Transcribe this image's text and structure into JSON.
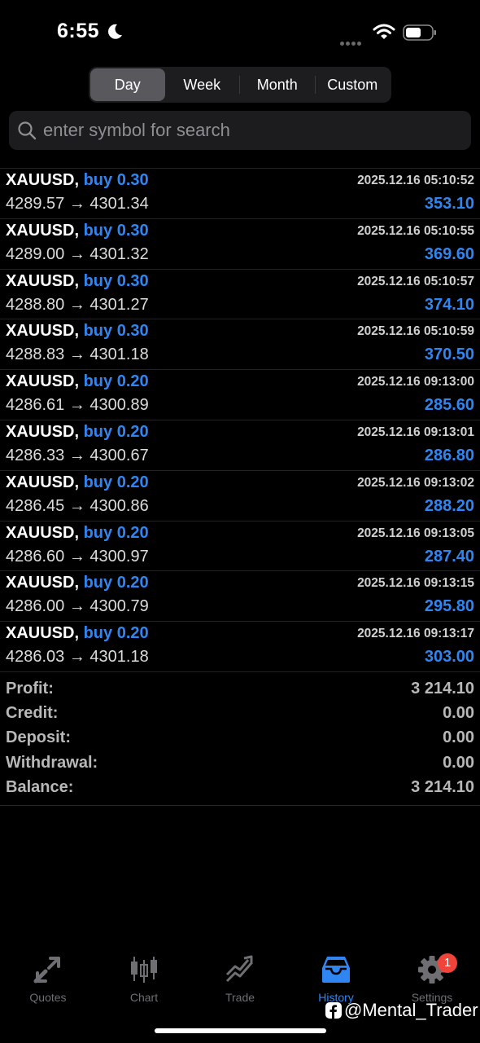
{
  "status_bar": {
    "time": "6:55"
  },
  "segments": [
    {
      "label": "Day",
      "active": true
    },
    {
      "label": "Week",
      "active": false
    },
    {
      "label": "Month",
      "active": false
    },
    {
      "label": "Custom",
      "active": false
    }
  ],
  "search": {
    "placeholder": "enter symbol for search"
  },
  "trades": [
    {
      "symbol": "XAUUSD,",
      "side": "buy 0.30",
      "datetime": "2025.12.16 05:10:52",
      "prices": "4289.57 → 4301.34",
      "profit": "353.10"
    },
    {
      "symbol": "XAUUSD,",
      "side": "buy 0.30",
      "datetime": "2025.12.16 05:10:55",
      "prices": "4289.00 → 4301.32",
      "profit": "369.60"
    },
    {
      "symbol": "XAUUSD,",
      "side": "buy 0.30",
      "datetime": "2025.12.16 05:10:57",
      "prices": "4288.80 → 4301.27",
      "profit": "374.10"
    },
    {
      "symbol": "XAUUSD,",
      "side": "buy 0.30",
      "datetime": "2025.12.16 05:10:59",
      "prices": "4288.83 → 4301.18",
      "profit": "370.50"
    },
    {
      "symbol": "XAUUSD,",
      "side": "buy 0.20",
      "datetime": "2025.12.16 09:13:00",
      "prices": "4286.61 → 4300.89",
      "profit": "285.60"
    },
    {
      "symbol": "XAUUSD,",
      "side": "buy 0.20",
      "datetime": "2025.12.16 09:13:01",
      "prices": "4286.33 → 4300.67",
      "profit": "286.80"
    },
    {
      "symbol": "XAUUSD,",
      "side": "buy 0.20",
      "datetime": "2025.12.16 09:13:02",
      "prices": "4286.45 → 4300.86",
      "profit": "288.20"
    },
    {
      "symbol": "XAUUSD,",
      "side": "buy 0.20",
      "datetime": "2025.12.16 09:13:05",
      "prices": "4286.60 → 4300.97",
      "profit": "287.40"
    },
    {
      "symbol": "XAUUSD,",
      "side": "buy 0.20",
      "datetime": "2025.12.16 09:13:15",
      "prices": "4286.00 → 4300.79",
      "profit": "295.80"
    },
    {
      "symbol": "XAUUSD,",
      "side": "buy 0.20",
      "datetime": "2025.12.16 09:13:17",
      "prices": "4286.03 → 4301.18",
      "profit": "303.00"
    }
  ],
  "summary": [
    {
      "label": "Profit:",
      "value": "3 214.10"
    },
    {
      "label": "Credit:",
      "value": "0.00"
    },
    {
      "label": "Deposit:",
      "value": "0.00"
    },
    {
      "label": "Withdrawal:",
      "value": "0.00"
    },
    {
      "label": "Balance:",
      "value": "3 214.10"
    }
  ],
  "tabs": [
    {
      "label": "Quotes",
      "icon": "quotes-icon",
      "active": false
    },
    {
      "label": "Chart",
      "icon": "chart-icon",
      "active": false
    },
    {
      "label": "Trade",
      "icon": "trade-icon",
      "active": false
    },
    {
      "label": "History",
      "icon": "history-icon",
      "active": true
    },
    {
      "label": "Settings",
      "icon": "gear-icon",
      "active": false,
      "badge": "1"
    }
  ],
  "watermark": "@Mental_Trader",
  "colors": {
    "accent": "#2f86f2",
    "badge": "#f0443a",
    "background": "#000000"
  }
}
